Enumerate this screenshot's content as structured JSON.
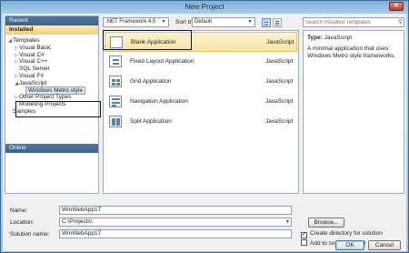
{
  "window": {
    "title": "New Project",
    "close_glyph": "✕"
  },
  "nav": {
    "recent_label": "Recent",
    "installed_label": "Installed",
    "online_label": "Online",
    "tree": [
      {
        "label": "Templates",
        "indent": 0,
        "toggle": "◢"
      },
      {
        "label": "Visual Basic",
        "indent": 1,
        "toggle": "▷"
      },
      {
        "label": "Visual C#",
        "indent": 1,
        "toggle": "▷"
      },
      {
        "label": "Visual C++",
        "indent": 1,
        "toggle": "▷"
      },
      {
        "label": "SQL Server",
        "indent": 1,
        "toggle": ""
      },
      {
        "label": "Visual F#",
        "indent": 1,
        "toggle": "▷"
      },
      {
        "label": "JavaScript",
        "indent": 1,
        "toggle": "◢"
      },
      {
        "label": "Windows Metro style",
        "indent": 2,
        "toggle": "",
        "selected": true
      },
      {
        "label": "Other Project Types",
        "indent": 1,
        "toggle": "▷"
      },
      {
        "label": "Modeling Projects",
        "indent": 1,
        "toggle": ""
      },
      {
        "label": "Samples",
        "indent": 0,
        "toggle": ""
      }
    ]
  },
  "toolbar": {
    "framework": ".NET Framework 4.5",
    "sort_label": "Sort by:",
    "sort_value": "Default",
    "search_placeholder": "Search Installed Templates"
  },
  "templates": [
    {
      "name": "Blank Application",
      "language": "JavaScript",
      "selected": true
    },
    {
      "name": "Fixed Layout Application",
      "language": "JavaScript"
    },
    {
      "name": "Grid Application",
      "language": "JavaScript"
    },
    {
      "name": "Navigation Application",
      "language": "JavaScript"
    },
    {
      "name": "Split Application",
      "language": "JavaScript"
    }
  ],
  "details": {
    "type_label": "Type:",
    "type_value": "JavaScript",
    "description": "A minimal application that uses Windows Metro style frameworks."
  },
  "form": {
    "name_label": "Name:",
    "name_value": "WinWebApp17",
    "location_label": "Location:",
    "location_value": "C:\\Projects\\",
    "solution_label": "Solution name:",
    "solution_value": "WinWebApp17",
    "browse_label": "Browse...",
    "create_dir_label": "Create directory for solution",
    "create_dir_checked": true,
    "add_source_label": "Add to source control",
    "add_source_checked": false,
    "ok_label": "OK",
    "cancel_label": "Cancel"
  },
  "colors": {
    "accent": "#3f6287",
    "selection": "#f8e4a4",
    "installed_header": "#f3cf77"
  }
}
